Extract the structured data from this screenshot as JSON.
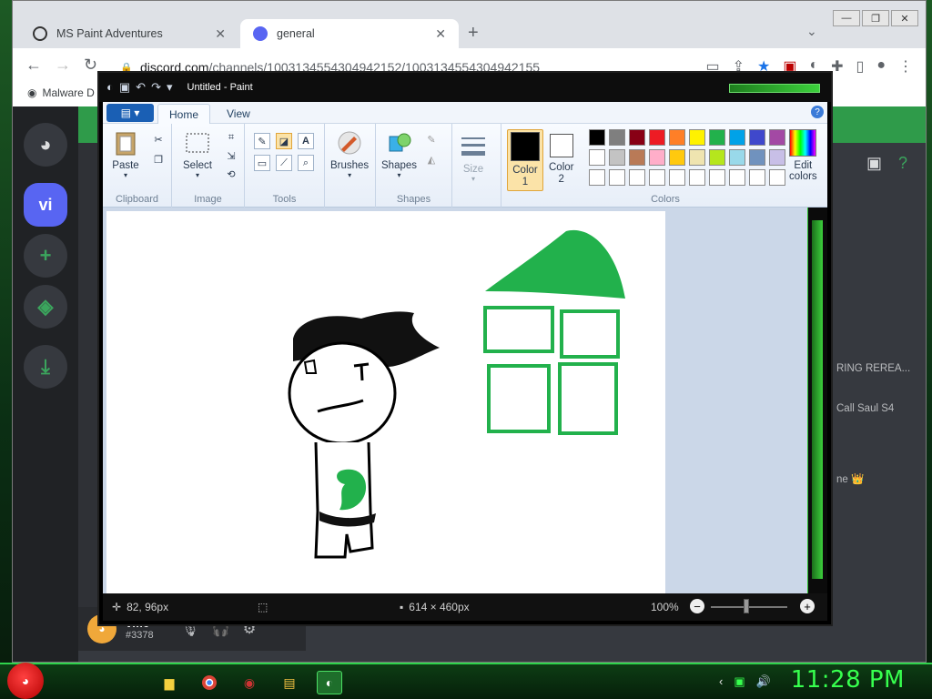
{
  "browser": {
    "tabs": [
      {
        "label": "MS Paint Adventures",
        "close": "✕"
      },
      {
        "label": "general",
        "close": "✕"
      }
    ],
    "new_tab": "+",
    "tab_menu": "⌄",
    "url_host": "discord.com",
    "url_path": "/channels/1003134554304942152/1003134554304942155",
    "bookmark_label": "Malware D",
    "window_buttons": [
      "—",
      "❐",
      "✕"
    ]
  },
  "discord": {
    "server_initials": "vi",
    "member_snippets": [
      "RING REREA...",
      "Call Saul S4",
      "ne 👑"
    ],
    "user": {
      "name": "vm6",
      "tag": "#3378"
    }
  },
  "paint": {
    "title": "Untitled - Paint",
    "tabs": {
      "home": "Home",
      "view": "View"
    },
    "groups": {
      "clipboard": "Clipboard",
      "image": "Image",
      "tools": "Tools",
      "shapes": "Shapes",
      "colors": "Colors"
    },
    "buttons": {
      "paste": "Paste",
      "select": "Select",
      "brushes": "Brushes",
      "shapes": "Shapes",
      "size": "Size",
      "color1": "Color 1",
      "color1_num": "1",
      "color1_word": "Color",
      "color2_word": "Color",
      "color2_num": "2",
      "edit_colors_1": "Edit",
      "edit_colors_2": "colors"
    },
    "palette_row1": [
      "#000000",
      "#7f7f7f",
      "#880015",
      "#ed1c24",
      "#ff7f27",
      "#fff200",
      "#22b14c",
      "#00a2e8",
      "#3f48cc",
      "#a349a4"
    ],
    "palette_row2": [
      "#ffffff",
      "#c3c3c3",
      "#b97a57",
      "#ffaec9",
      "#ffc90e",
      "#efe4b0",
      "#b5e61d",
      "#99d9ea",
      "#7092be",
      "#c8bfe7"
    ],
    "palette_row3": [
      "#ffffff",
      "#ffffff",
      "#ffffff",
      "#ffffff",
      "#ffffff",
      "#ffffff",
      "#ffffff",
      "#ffffff",
      "#ffffff",
      "#ffffff"
    ],
    "status": {
      "cursor": "82, 96px",
      "size": "614 × 460px",
      "zoom": "100%"
    }
  },
  "taskbar": {
    "clock": "11:28 PM"
  }
}
